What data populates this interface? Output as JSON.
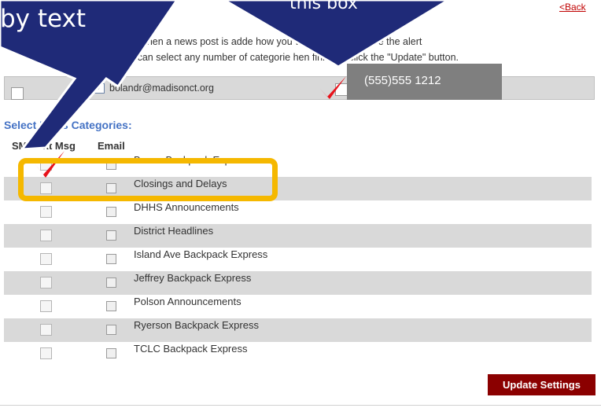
{
  "header": {
    "back_label": "<Back"
  },
  "intro": {
    "line1": "alert when a news post is adde                    how you would like to receive the alert",
    "line2": "You can select any number of categorie          hen finished click the \"Update\" button."
  },
  "contact": {
    "email_checked_glyph": "✓",
    "email_address": "bolandr@madisonct.org",
    "phone_overlay": "(555)555 1212"
  },
  "categories": {
    "title": "Select News Categories:",
    "col_sms": "SMS/Txt Msg",
    "col_email": "Email",
    "items": [
      {
        "label": "Bacon Backpack Express"
      },
      {
        "label": "Closings and Delays"
      },
      {
        "label": "DHHS Announcements"
      },
      {
        "label": "District Headlines"
      },
      {
        "label": "Island Ave Backpack Express"
      },
      {
        "label": "Jeffrey Backpack Express"
      },
      {
        "label": "Polson Announcements"
      },
      {
        "label": "Ryerson Backpack Express"
      },
      {
        "label": "TCLC Backpack Express"
      }
    ]
  },
  "actions": {
    "update_label": "Update Settings"
  },
  "annotations": {
    "left_callout_text": "by text",
    "center_callout_text": "this box",
    "callout_color": "#1f2a78",
    "highlight_color": "#f5b800",
    "checkmark_color": "#e8121b"
  }
}
